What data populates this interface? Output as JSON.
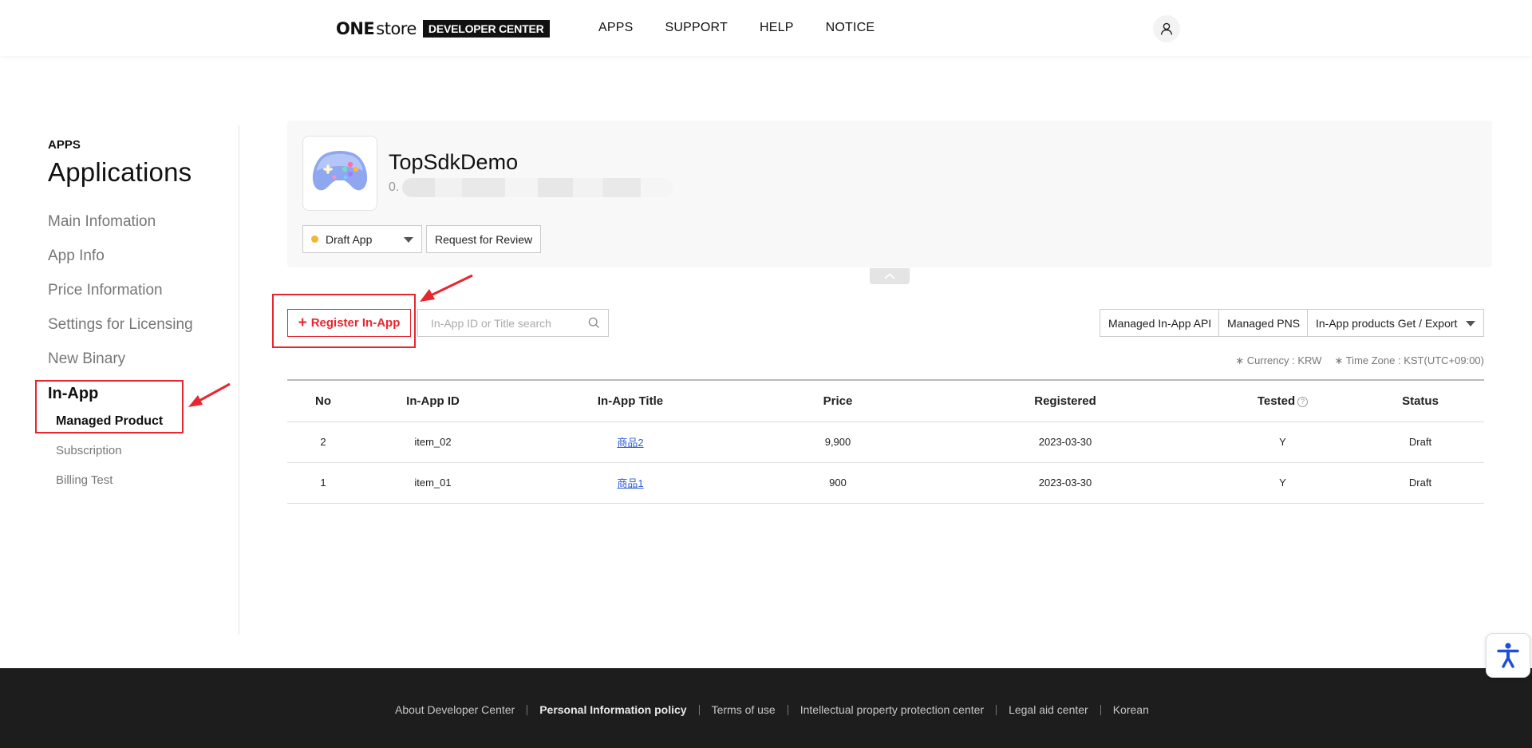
{
  "header": {
    "logo_one": "ONE",
    "logo_store": "store",
    "logo_badge": "DEVELOPER CENTER",
    "nav": [
      "APPS",
      "SUPPORT",
      "HELP",
      "NOTICE"
    ]
  },
  "sidebar": {
    "eyebrow": "APPS",
    "title": "Applications",
    "items": [
      "Main Infomation",
      "App Info",
      "Price Information",
      "Settings for Licensing",
      "New Binary"
    ],
    "inapp_label": "In-App",
    "sub_items": [
      "Managed Product",
      "Subscription",
      "Billing Test"
    ],
    "active_sub": "Managed Product"
  },
  "app": {
    "name": "TopSdkDemo",
    "package_prefix": "0.",
    "status": "Draft App",
    "status_color": "#f2b632",
    "review_button": "Request for Review"
  },
  "toolbar": {
    "register_button": "Register In-App",
    "search_placeholder": "In-App ID or Title search",
    "api_button": "Managed In-App API",
    "pns_button": "Managed PNS",
    "export_select": "In-App products Get / Export",
    "currency": "∗ Currency : KRW",
    "timezone": "∗ Time Zone : KST(UTC+09:00)"
  },
  "table": {
    "headers": [
      "No",
      "In-App ID",
      "In-App Title",
      "Price",
      "Registered",
      "Tested",
      "Status"
    ],
    "rows": [
      {
        "no": "2",
        "id": "item_02",
        "title": "商品2",
        "price": "9,900",
        "registered": "2023-03-30",
        "tested": "Y",
        "status": "Draft"
      },
      {
        "no": "1",
        "id": "item_01",
        "title": "商品1",
        "price": "900",
        "registered": "2023-03-30",
        "tested": "Y",
        "status": "Draft"
      }
    ]
  },
  "footer": {
    "links": [
      "About Developer Center",
      "Personal Information policy",
      "Terms of use",
      "Intellectual property protection center",
      "Legal aid center",
      "Korean"
    ]
  },
  "colors": {
    "accent_red": "#e8262f",
    "link_blue": "#2f5fd6",
    "footer_bg": "#1d1d1d"
  },
  "icons": {
    "user": "user-icon",
    "search": "search-icon",
    "accessibility": "accessibility-icon",
    "collapse": "chevron-up-icon"
  }
}
